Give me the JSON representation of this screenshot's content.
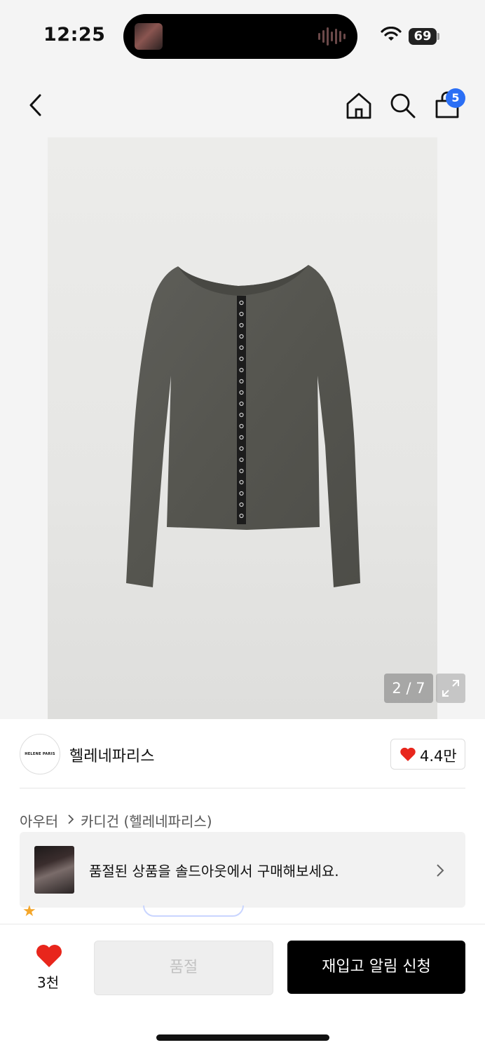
{
  "status_bar": {
    "time": "12:25",
    "battery": "69"
  },
  "header": {
    "cart_count": "5"
  },
  "gallery": {
    "counter": "2 / 7"
  },
  "brand": {
    "logo_text": "HELENE PARIS",
    "name": "헬레네파리스",
    "likes": "4.4만"
  },
  "breadcrumb": {
    "category": "아우터",
    "subcategory": "카디건 (헬레네파리스)"
  },
  "soldout_banner": {
    "text": "품절된 상품을 솔드아웃에서 구매해보세요."
  },
  "bottom_bar": {
    "wish_count": "3천",
    "soldout_label": "품절",
    "restock_label": "재입고 알림 신청"
  },
  "colors": {
    "accent_blue": "#2b6ff5",
    "heart_red": "#e8261c",
    "primary_black": "#000000"
  }
}
